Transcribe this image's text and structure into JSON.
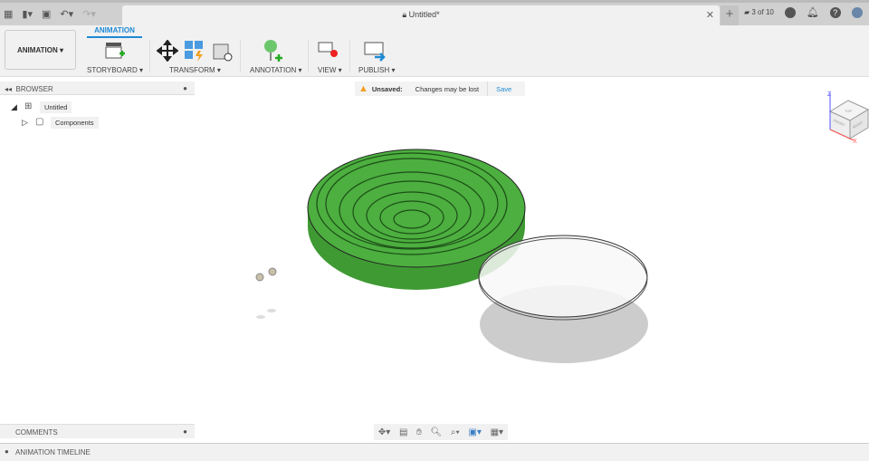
{
  "title_bar": {
    "document_title": "Untitled*",
    "job_status": "3 of 10"
  },
  "toolbar": {
    "workspace": "ANIMATION",
    "active_tab": "ANIMATION",
    "groups": [
      {
        "label": "STORYBOARD ▾"
      },
      {
        "label": "TRANSFORM ▾"
      },
      {
        "label": "ANNOTATION ▾"
      },
      {
        "label": "VIEW ▾"
      },
      {
        "label": "PUBLISH ▾"
      }
    ]
  },
  "browser": {
    "header": "BROWSER",
    "root": "Untitled",
    "child": "Components"
  },
  "notice": {
    "label": "Unsaved:",
    "message": "Changes may be lost",
    "save": "Save"
  },
  "viewcube": {
    "top": "TOP",
    "front": "FRONT",
    "right": "RIGHT",
    "z": "Z",
    "x": "X"
  },
  "comments": {
    "label": "COMMENTS"
  },
  "timeline": {
    "label": "ANIMATION TIMELINE"
  },
  "colors": {
    "accent": "#1e8ad6",
    "model": "#4caf3f"
  }
}
